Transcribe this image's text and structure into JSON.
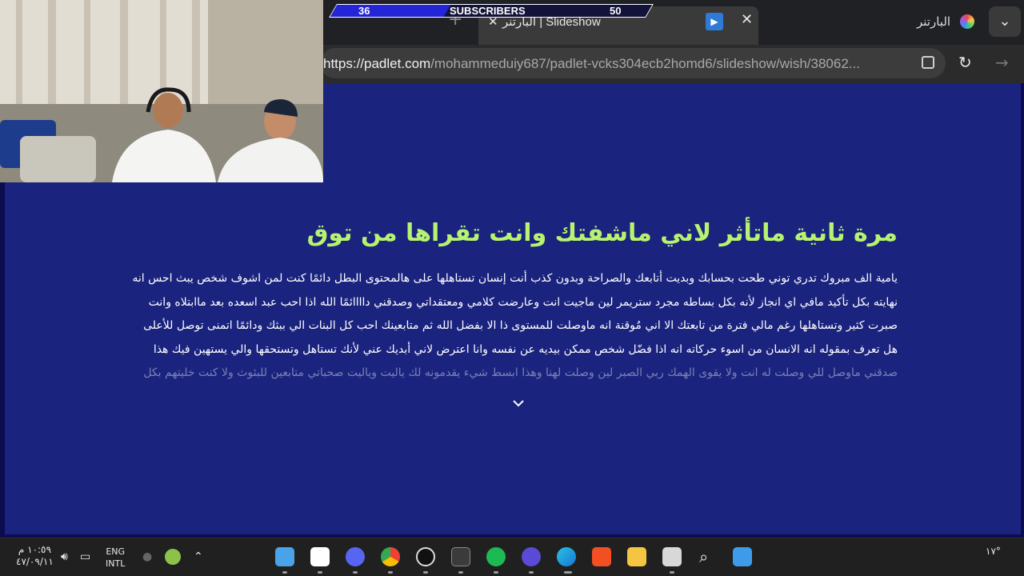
{
  "browser": {
    "active_tab_title": "البارتنر | Slideshow",
    "other_tab_title": "البارتنر",
    "url_host": "https://padlet.com",
    "url_path": "/mohammeduiy687/padlet-vcks304ecb2homd6/slideshow/wish/38062..."
  },
  "banner": {
    "left_count": "36",
    "label": "SUBSCRIBERS",
    "right_count": "50",
    "progress_fraction": 0.36
  },
  "post": {
    "title": "مرة ثانية ماتأثر لاني ماشفتك وانت تقراها من توق",
    "lines": [
      "يامية الف مبروك تدري توني طحت بحسابك وبديت أتابعك والصراحة وبدون كذب أنت إنسان تستاهلها على هالمحتوى البطل دائمًا كنت لمن اشوف شخص يبث احس انه",
      "نهايته بكل تأكيد مافي اي انجاز لأنه بكل بساطه مجرد ستريمر لين ماجيت انت وعارضت كلامي ومعتقداتي وصدقني داااائمًا الله اذا احب عبد اسعده بعد ماابتلاه وانت",
      "صبرت كثير وتستاهلها رغم مالي فترة من تابعتك الا اني مُوقنة انه ماوصلت للمستوى ذا الا بفضل الله ثم متابعينك احب كل البنات الي ببثك ودائمًا اتمنى توصل للأعلى",
      "هل تعرف بمقوله انه الانسان من اسوء حركاته انه اذا فضّل شخص ممكن بيديه عن نفسه وانا اعترض لاني أبديك عني لأنك تستاهل وتستحقها والي يستهين فيك هذا",
      "صدقني ماوصل للي وصلت له انت ولا يقوى الهمك ربي الصبر لين وصلت لهنا وهذا ابسط شيء يقدمونه لك ياليت وياليت صحباتي متابعين للبثوث ولا كنت خليتهم بكل"
    ]
  },
  "taskbar": {
    "time": "١٠:٥٩ م",
    "date": "٤٧/٠٩/١١",
    "lang_primary": "ENG",
    "lang_secondary": "INTL",
    "temperature": "١٧°"
  },
  "colors": {
    "page_background": "#1a237e",
    "title_color": "#b7f36f",
    "banner_fill": "#2424d8"
  }
}
